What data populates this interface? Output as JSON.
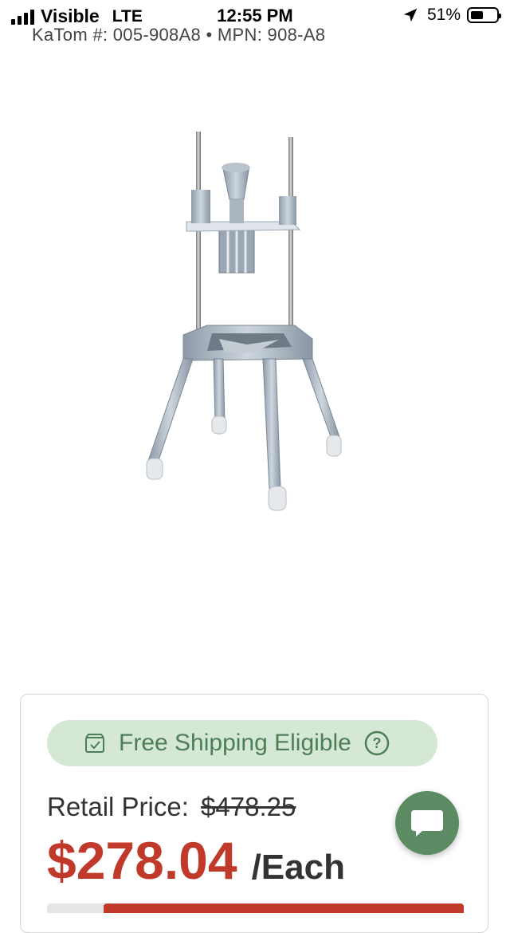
{
  "status_bar": {
    "carrier": "Visible",
    "network": "LTE",
    "time": "12:55 PM",
    "battery_percent": "51%",
    "battery_level": 0.51,
    "signal_bars": 4,
    "icons": [
      "signal-icon",
      "location-arrow-icon",
      "battery-icon"
    ]
  },
  "product": {
    "sku_line": "KaTom #: 005-908A8 • MPN: 908-A8",
    "image": "product-image"
  },
  "shipping": {
    "label": "Free Shipping Eligible",
    "icons": [
      "box-check-icon",
      "help-icon"
    ]
  },
  "pricing": {
    "retail_label": "Retail Price:",
    "retail_value": "$478.25",
    "sale_price": "$278.04",
    "unit": "/Each"
  },
  "chat": {
    "icon": "chat-icon"
  },
  "colors": {
    "accent_green": "#5c8a63",
    "badge_bg": "#d5e8d6",
    "badge_text": "#4e7e57",
    "price_red": "#c0392b"
  }
}
